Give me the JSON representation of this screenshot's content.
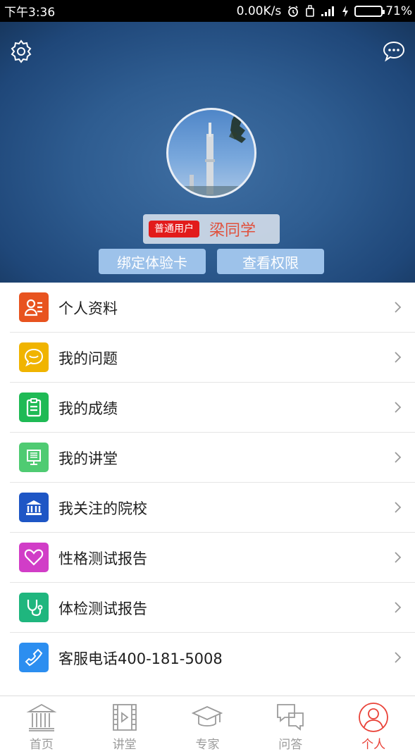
{
  "status_bar": {
    "time": "下午3:36",
    "network_speed": "0.00K/s",
    "battery": "71%",
    "battery_level": 0.71
  },
  "header": {
    "user_type": "普通用户",
    "user_name": "梁同学",
    "bind_card_label": "绑定体验卡",
    "view_permissions_label": "查看权限"
  },
  "menu": {
    "items": [
      {
        "label": "个人资料",
        "icon": "profile-icon",
        "color": "#e8531f"
      },
      {
        "label": "我的问题",
        "icon": "chat-bubble-icon",
        "color": "#f0b400"
      },
      {
        "label": "我的成绩",
        "icon": "clipboard-icon",
        "color": "#1fba55"
      },
      {
        "label": "我的讲堂",
        "icon": "lecture-screen-icon",
        "color": "#4fcb72"
      },
      {
        "label": "我关注的院校",
        "icon": "institution-icon",
        "color": "#1e56c5"
      },
      {
        "label": "性格测试报告",
        "icon": "heart-icon",
        "color": "#d13dc7"
      },
      {
        "label": "体检测试报告",
        "icon": "stethoscope-icon",
        "color": "#1fb67e"
      },
      {
        "label": "客服电话400-181-5008",
        "icon": "phone-icon",
        "color": "#2c8ef0"
      }
    ]
  },
  "bottom_nav": {
    "tabs": [
      {
        "label": "首页",
        "icon": "home-building-icon",
        "active": false
      },
      {
        "label": "讲堂",
        "icon": "film-icon",
        "active": false
      },
      {
        "label": "专家",
        "icon": "graduation-cap-icon",
        "active": false
      },
      {
        "label": "问答",
        "icon": "chat-boxes-icon",
        "active": false
      },
      {
        "label": "个人",
        "icon": "person-icon",
        "active": true
      }
    ],
    "active_color": "#e94238",
    "inactive_color": "#9b9b9b"
  }
}
